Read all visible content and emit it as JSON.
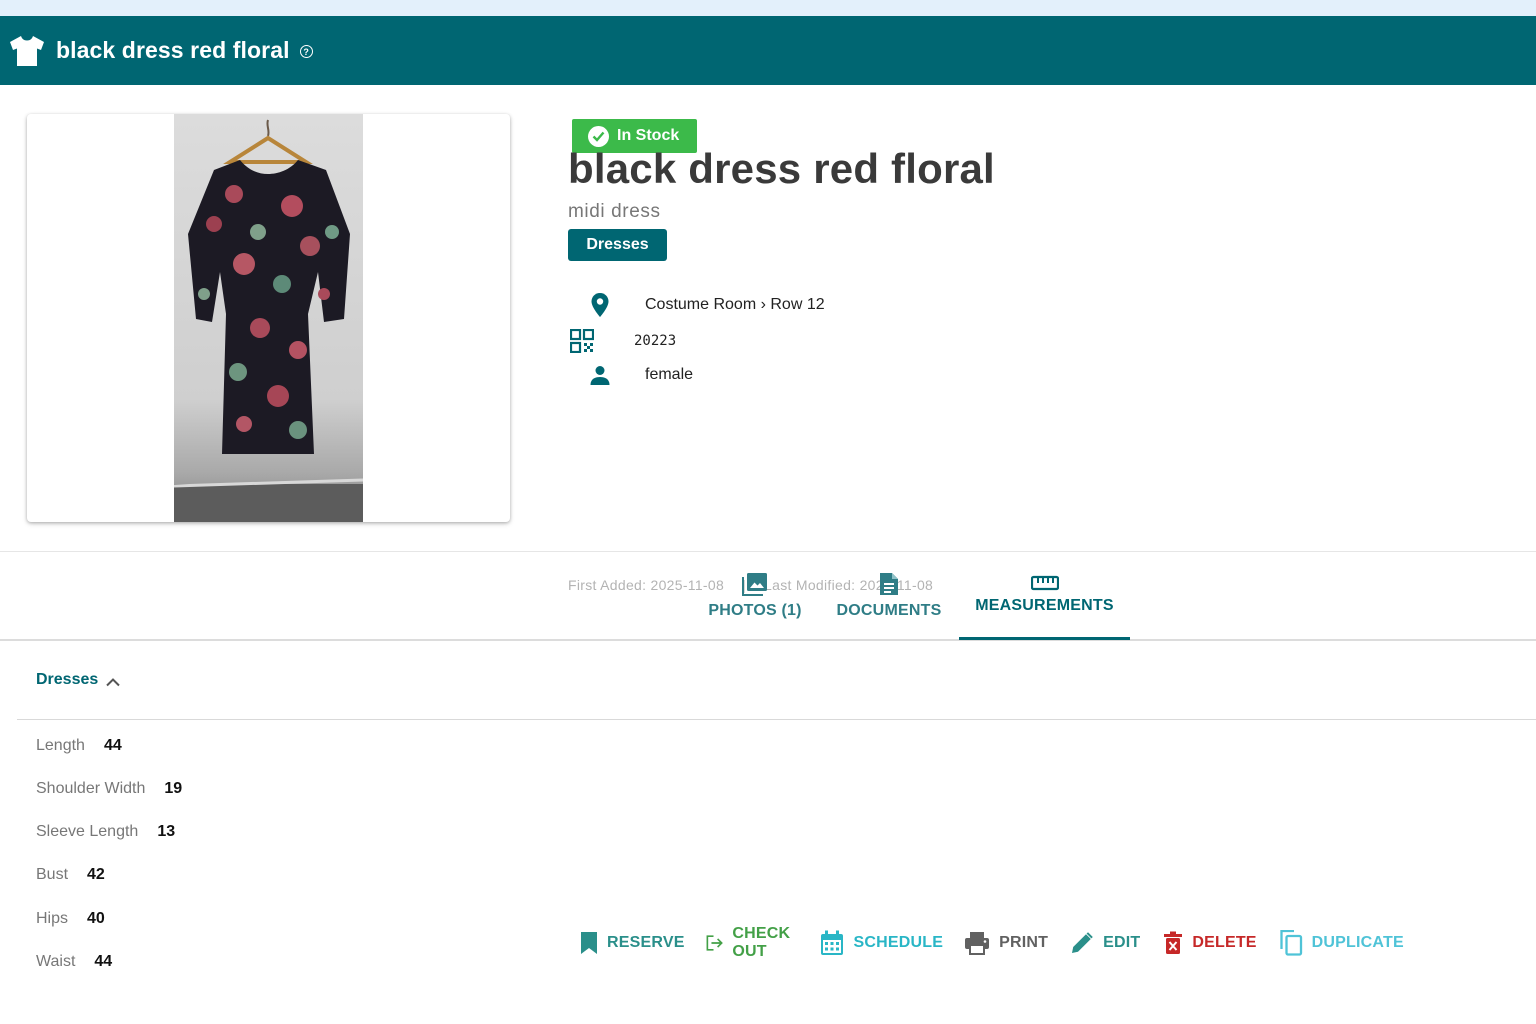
{
  "app_bar": {
    "title": "black dress red floral",
    "help_glyph": "?"
  },
  "item": {
    "status": "In Stock",
    "title": "black dress red floral",
    "subtitle": "midi dress",
    "category": "Dresses",
    "location": "Costume Room › Row 12",
    "sku": "20223",
    "gender": "female",
    "first_added": "First Added: 2025-11-08",
    "meta_separator": "|",
    "last_modified": "Last Modified: 2025-11-08"
  },
  "actions": {
    "reserve": "RESERVE",
    "check_out": "CHECK OUT",
    "schedule": "SCHEDULE",
    "print": "PRINT",
    "edit": "EDIT",
    "delete": "DELETE",
    "duplicate": "DUPLICATE"
  },
  "tabs": {
    "photos": "PHOTOS (1)",
    "documents": "DOCUMENTS",
    "measurements": "MEASUREMENTS"
  },
  "measurements": {
    "section_title": "Dresses",
    "rows": [
      {
        "label": "Length",
        "value": "44"
      },
      {
        "label": "Shoulder Width",
        "value": "19"
      },
      {
        "label": "Sleeve Length",
        "value": "13"
      },
      {
        "label": "Bust",
        "value": "42"
      },
      {
        "label": "Hips",
        "value": "40"
      },
      {
        "label": "Waist",
        "value": "44"
      }
    ]
  },
  "colors": {
    "brand": "#006672",
    "in_stock": "#3cba4a",
    "reserve": "#2a8f8a",
    "check_out": "#43a047",
    "schedule": "#29b6c6",
    "print": "#616161",
    "edit": "#2a8f8a",
    "delete": "#c62828",
    "duplicate": "#4fc3d7"
  },
  "icons": {
    "app": "shirt-icon",
    "status": "check-circle-icon",
    "location": "map-pin-icon",
    "sku": "qr-code-icon",
    "gender": "person-icon"
  }
}
